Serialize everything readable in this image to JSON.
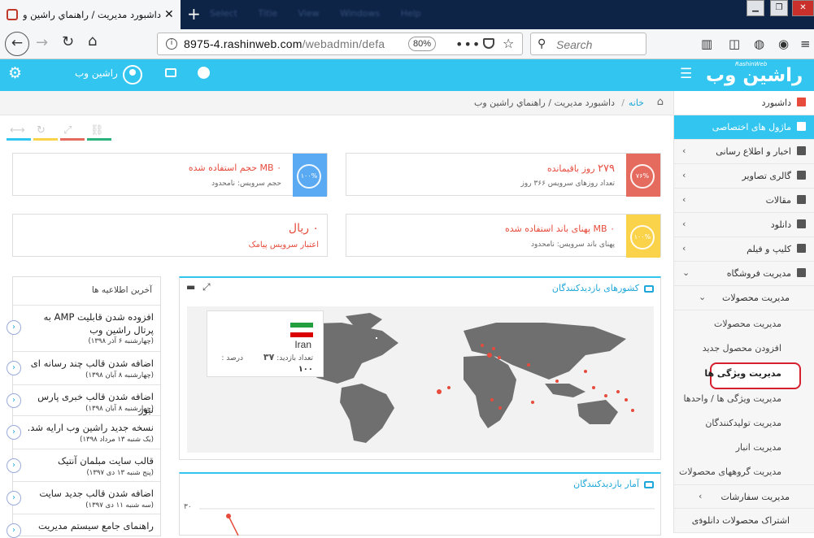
{
  "browser": {
    "tab_title": "داشبورد مدیریت / راهنماي راشين وب",
    "ghost_menu": "Select Title View Windows Help",
    "url_domain": "8975-4.rashinweb.com",
    "url_path": "/webadmin/defa",
    "zoom": "80%",
    "search_placeholder": "Search"
  },
  "header": {
    "username": "راشین وب",
    "logo_text": "راشین وب",
    "logo_small": "RashinWeb"
  },
  "breadcrumb": {
    "home": "خانه",
    "separator": "/",
    "current": "داشبورد مدیریت / راهنماي راشين وب"
  },
  "stats": {
    "days": {
      "value": "۲۷۹",
      "label": "روز باقیمانده",
      "sub": "تعداد روزهای سرویس ۳۶۶ روز",
      "percent": "۷۶%",
      "color": "#e66b5f"
    },
    "disk": {
      "value": "۰ MB",
      "label": "حجم استفاده شده",
      "sub": "حجم سرویس: نامحدود",
      "percent": "۱۰۰%",
      "color": "#5aa9f3"
    },
    "bandwidth": {
      "value": "۰ MB",
      "label": "پهنای باند استفاده شده",
      "sub": "پهنای باند سرویس: نامحدود",
      "percent": "۱۰۰%",
      "color": "#fbd34a"
    },
    "sms": {
      "value": "۰ ریال",
      "label": "اعتبار سرویس پیامک"
    }
  },
  "countries_panel": {
    "title": "کشورهای بازدیدکنندگان",
    "country": "Iran",
    "visits_label": "تعداد بازدید:",
    "visits": "۳۷",
    "percent_label": "درصد :",
    "percent": "۱۰۰"
  },
  "stats_panel": {
    "title": "آمار بازدیدکنندگان",
    "y_tick": "۳۰"
  },
  "notices": {
    "title": "آخرین اطلاعیه ها",
    "items": [
      {
        "title": "افزوده شدن قابلیت AMP به پرتال راشین وب",
        "date": "(چهارشنبه ۶ آذر ۱۳۹۸)"
      },
      {
        "title": "اضافه شدن قالب چند رسانه ای",
        "date": "(چهارشنبه ۸ آبان ۱۳۹۸)"
      },
      {
        "title": "اضافه شدن قالب خبری پارس نیوز",
        "date": "(چهارشنبه ۸ آبان ۱۳۹۸)"
      },
      {
        "title": "نسخه جدید راشین وب ارایه شد.",
        "date": "(یک شنبه ۱۳ مرداد ۱۳۹۸)"
      },
      {
        "title": "قالب سایت مبلمان آنتیک",
        "date": "(پنج شنبه ۱۳ دی ۱۳۹۷)"
      },
      {
        "title": "اضافه شدن قالب جدید سایت",
        "date": "(سه شنبه ۱۱ دی ۱۳۹۷)"
      },
      {
        "title": "راهنمای جامع سیستم مدیریت",
        "date": ""
      }
    ]
  },
  "sidebar": {
    "dashboard": "داشبورد",
    "modules": "ماژول های اختصاصی",
    "items": [
      "اخبار و اطلاع رسانی",
      "گالری تصاویر",
      "مقالات",
      "دانلود",
      "کلیپ و فیلم",
      "مدیریت فروشگاه"
    ],
    "products_group": "مدیریت محصولات",
    "sub_items": [
      "مدیریت محصولات",
      "افزودن محصول جدید",
      "مدیریت ویژگی ها",
      "مدیریت ویژگی ها / واحدها",
      "مدیریت تولیدکنندگان",
      "مدیریت انبار",
      "مدیریت گروههای محصولات"
    ],
    "orders": "مدیریت سفارشات",
    "downloads": "اشتراک محصولات دانلودی"
  }
}
